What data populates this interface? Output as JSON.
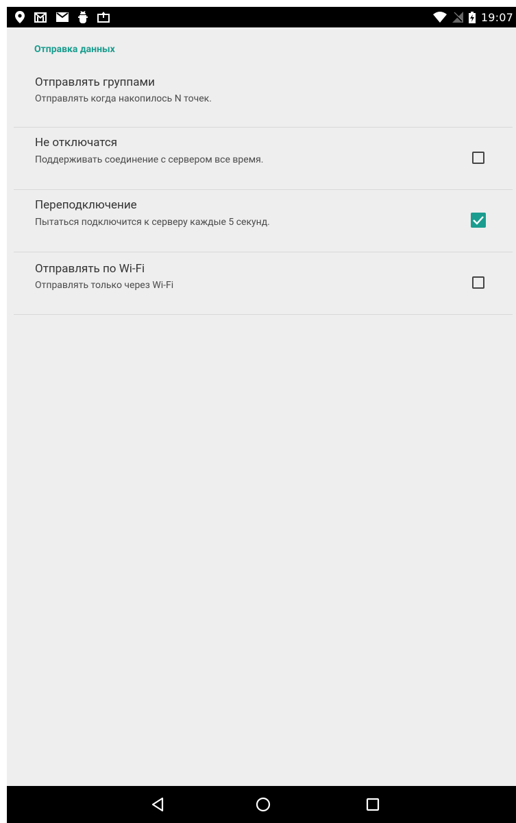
{
  "status_bar": {
    "time": "19:07",
    "icons_left": [
      "location-icon",
      "gmail-icon",
      "email-icon",
      "android-debug-icon",
      "photo-upload-icon"
    ],
    "icons_right": [
      "wifi-icon",
      "signal-off-icon",
      "battery-charging-icon"
    ]
  },
  "settings": {
    "category_title": "Отправка данных",
    "items": [
      {
        "title": "Отправлять группами",
        "summary": "Отправлять когда накопилось N точек.",
        "has_checkbox": false
      },
      {
        "title": "Не отключатся",
        "summary": "Поддерживать соединение с сервером все время.",
        "has_checkbox": true,
        "checked": false
      },
      {
        "title": "Переподключение",
        "summary": "Пытаться подключится к серверу каждые 5 секунд.",
        "has_checkbox": true,
        "checked": true
      },
      {
        "title": "Отправлять по Wi-Fi",
        "summary": "Отправлять только через Wi-Fi",
        "has_checkbox": true,
        "checked": false
      }
    ]
  },
  "navigation": {
    "buttons": [
      "back-icon",
      "home-icon",
      "recents-icon"
    ]
  },
  "colors": {
    "accent": "#1a9d8f",
    "background": "#eeeeee",
    "bars": "#000000"
  }
}
